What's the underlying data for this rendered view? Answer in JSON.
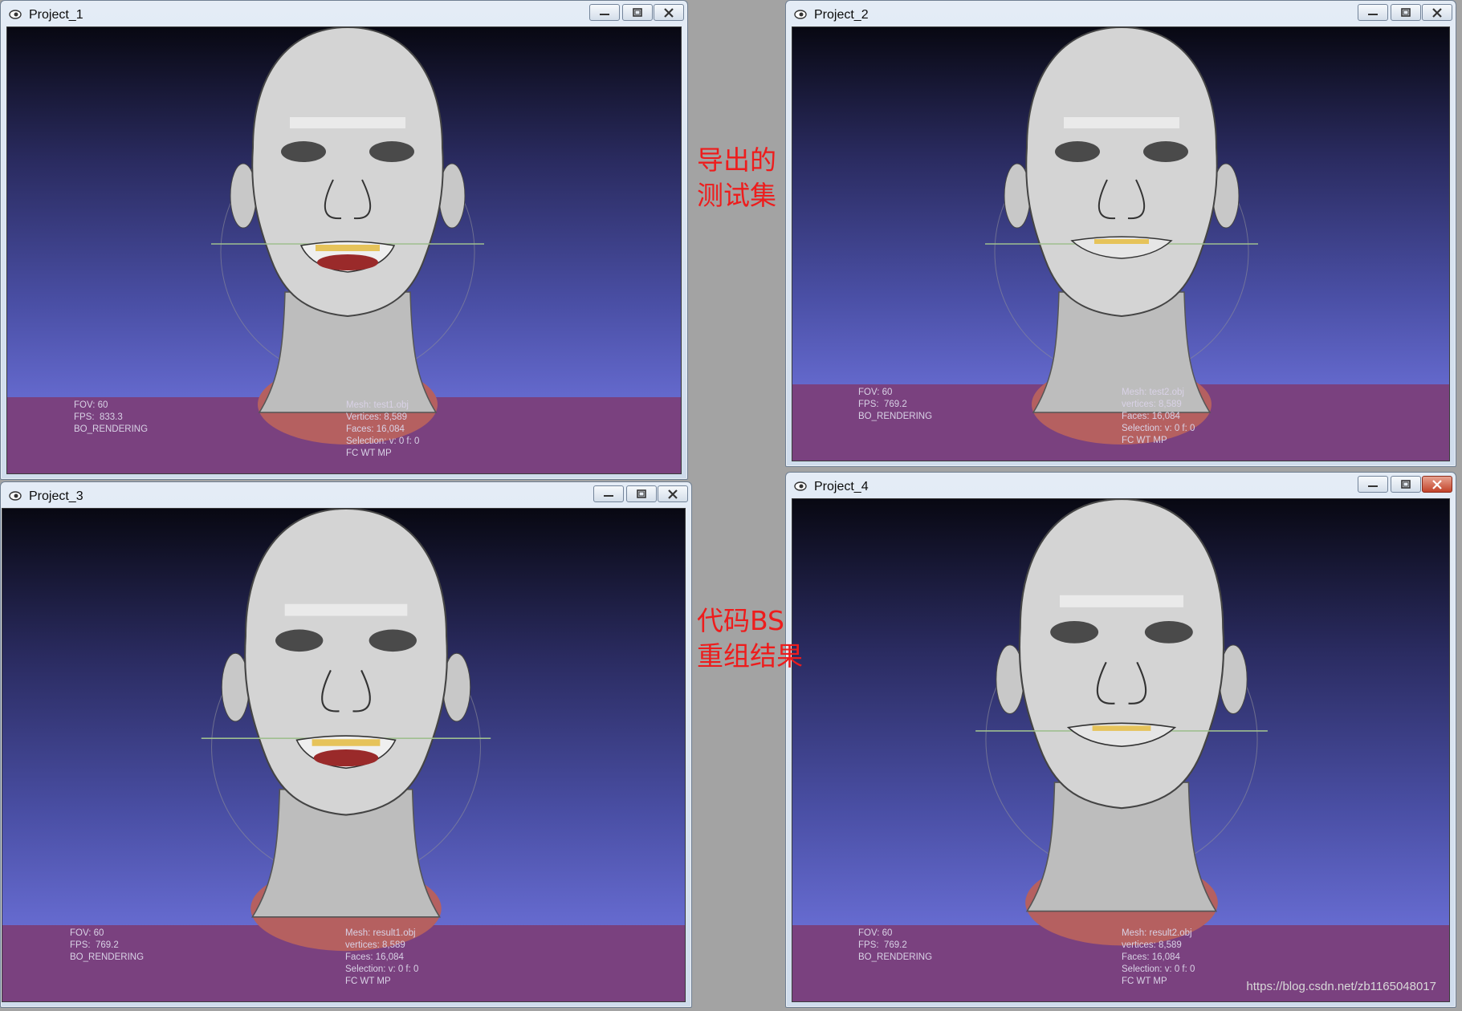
{
  "annotations": {
    "top": [
      "导出的",
      "测试集"
    ],
    "bottom": [
      "代码BS",
      "重组结果"
    ]
  },
  "windows": [
    {
      "title": "Project_1",
      "hud_left": [
        "FOV: 60",
        "FPS:  833.3",
        "BO_RENDERING"
      ],
      "hud_right": [
        "Mesh: test1.obj",
        "Vertices: 8,589",
        "Faces: 16,084",
        "Selection: v: 0 f: 0",
        "FC WT MP"
      ],
      "mouth": "open",
      "close_active": false
    },
    {
      "title": "Project_2",
      "hud_left": [
        "FOV: 60",
        "FPS:  769.2",
        "BO_RENDERING"
      ],
      "hud_right": [
        "Mesh: test2.obj",
        "vertices: 8,589",
        "Faces: 16,084",
        "Selection: v: 0 f: 0",
        "FC WT MP"
      ],
      "mouth": "closed",
      "close_active": false
    },
    {
      "title": "Project_3",
      "hud_left": [
        "FOV: 60",
        "FPS:  769.2",
        "BO_RENDERING"
      ],
      "hud_right": [
        "Mesh: result1.obj",
        "vertices: 8,589",
        "Faces: 16,084",
        "Selection: v: 0 f: 0",
        "FC WT MP"
      ],
      "mouth": "open",
      "close_active": false
    },
    {
      "title": "Project_4",
      "hud_left": [
        "FOV: 60",
        "FPS:  769.2",
        "BO_RENDERING"
      ],
      "hud_right": [
        "Mesh: result2.obj",
        "vertices: 8,589",
        "Faces: 16,084",
        "Selection: v: 0 f: 0",
        "FC WT MP"
      ],
      "mouth": "closed",
      "close_active": true
    }
  ],
  "icons": {
    "window_icon": "eye-icon",
    "minimize": "minimize-icon",
    "maximize": "maximize-icon",
    "close": "close-icon"
  },
  "colors": {
    "annotation": "#ee1c1c",
    "selection_band": "#7a417f",
    "mesh": "#d4d4d4"
  },
  "watermark": "https://blog.csdn.net/zb1165048017"
}
